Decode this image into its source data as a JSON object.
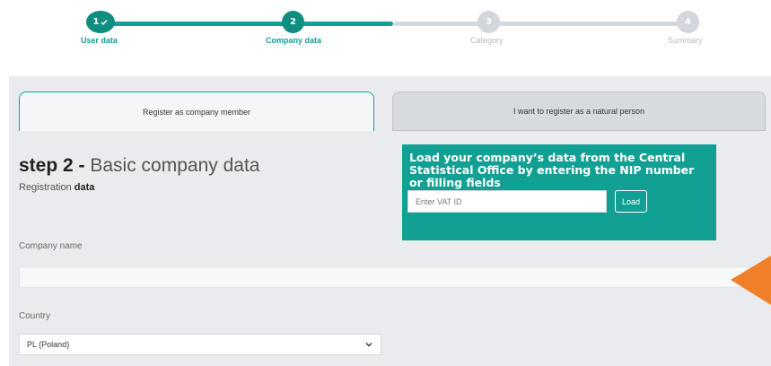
{
  "stepper": {
    "steps": [
      {
        "number": "1",
        "label": "User data",
        "state": "done"
      },
      {
        "number": "2",
        "label": "Company data",
        "state": "active"
      },
      {
        "number": "3",
        "label": "Category",
        "state": "inactive"
      },
      {
        "number": "4",
        "label": "Summary",
        "state": "inactive"
      }
    ]
  },
  "tabs": {
    "company": "Register as company member",
    "natural": "I want to register as a natural person"
  },
  "heading": {
    "step": "step 2 -",
    "title": "Basic company data",
    "sub_light": "Registration",
    "sub_bold": "data"
  },
  "gus": {
    "title": "Load your company’s data from the Central Statistical Office by entering the NIP number or filling fields",
    "vat_placeholder": "Enter VAT ID",
    "load_label": "Load"
  },
  "form": {
    "company_name_label": "Company name",
    "company_name_value": "",
    "country_label": "Country",
    "country_value": "PL (Poland)"
  },
  "colors": {
    "accent": "#12a094",
    "accent_dark": "#0f8d81",
    "arrow": "#f07f2a",
    "panel": "#e9ebee"
  },
  "icons": {
    "done_step": "check-icon",
    "select": "chevron-down-icon",
    "pointer": "orange-arrow-icon"
  }
}
